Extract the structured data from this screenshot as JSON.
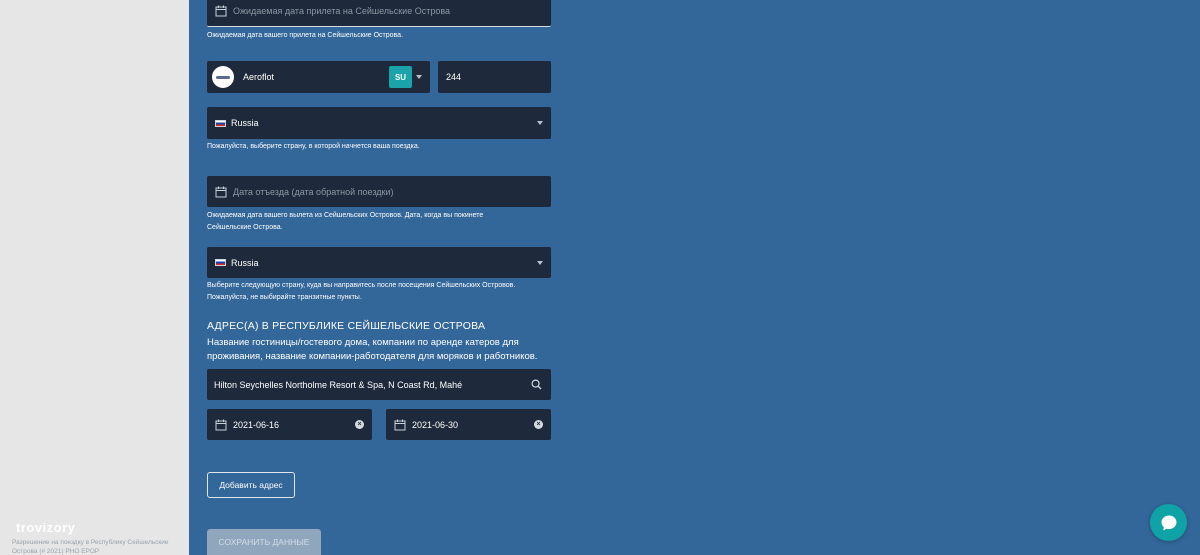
{
  "sidebar": {
    "logo": "trovizory",
    "footer_text": "Разрешение на поездку в Республику Сейшельские Острова (# 2021) РНО ЕРОР"
  },
  "arrival": {
    "date_placeholder": "Ожидаемая дата прилета на Сейшельские Острова",
    "hint": "Ожидаемая дата вашего прилета на Сейшельские Острова."
  },
  "flight": {
    "airline_name": "Aeroflot",
    "airline_code": "SU",
    "flight_number": "244"
  },
  "departure_country": {
    "value": "Russia",
    "hint": "Пожалуйста, выберите страну, в которой начнется ваша поездка."
  },
  "departure": {
    "date_placeholder": "Дата отъезда (дата обратной поездки)",
    "hint_line1": "Ожидаемая дата вашего вылета из Сейшельских Островов. Дата, когда вы покинете",
    "hint_line2": "Сейшельские Острова."
  },
  "next_country": {
    "value": "Russia",
    "hint_line1": "Выберите следующую страну, куда вы направитесь после посещения Сейшельских Островов.",
    "hint_line2": "Пожалуйста, не выбирайте транзитные пункты."
  },
  "address": {
    "title": "АДРЕС(А) В РЕСПУБЛИКЕ СЕЙШЕЛЬСКИЕ ОСТРОВА",
    "description": "Название гостиницы/гостевого дома, компании по аренде катеров для проживания, название компании-работодателя для моряков и работников.",
    "value": "Hilton Seychelles Northolme Resort & Spa, N Coast Rd, Mahé",
    "date_from": "2021-06-16",
    "date_to": "2021-06-30",
    "add_button": "Добавить адрес"
  },
  "save_button": "СОХРАНИТЬ ДАННЫЕ",
  "colors": {
    "background": "#336699",
    "field": "#1e2a3b",
    "accent": "#1aa3a8"
  },
  "icons": [
    "calendar-icon",
    "caret-down-icon",
    "search-icon",
    "clear-icon",
    "chat-icon",
    "flag-russia-icon"
  ]
}
